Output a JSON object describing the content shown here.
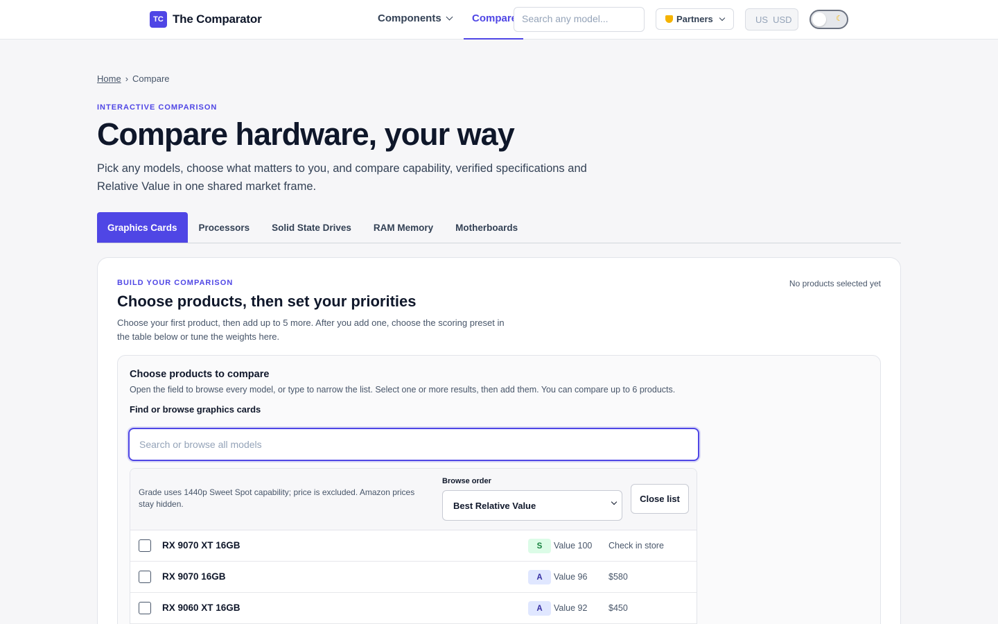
{
  "header": {
    "logo_mark": "TC",
    "logo_text": "The Comparator",
    "nav_components": "Components",
    "nav_compare": "Compare",
    "search_placeholder": "Search any model...",
    "partners": "Partners",
    "currency_country": "US",
    "currency_code": "USD",
    "theme_icon": "moon-icon"
  },
  "breadcrumb": {
    "home": "Home",
    "separator": "›",
    "current": "Compare"
  },
  "hero": {
    "eyebrow": "INTERACTIVE COMPARISON",
    "title": "Compare hardware, your way",
    "subtitle": "Pick any models, choose what matters to you, and compare capability, verified specifications and Relative Value in one shared market frame."
  },
  "tabs": [
    "Graphics Cards",
    "Processors",
    "Solid State Drives",
    "RAM Memory",
    "Motherboards"
  ],
  "builder": {
    "eyebrow": "BUILD YOUR COMPARISON",
    "title": "Choose products, then set your priorities",
    "description": "Choose your first product, then add up to 5 more. After you add one, choose the scoring preset in the table below or tune the weights here.",
    "status": "No products selected yet",
    "picker": {
      "title": "Choose products to compare",
      "description": "Open the field to browse every model, or type to narrow the list. Select one or more results, then add them. You can compare up to 6 products.",
      "field_label": "Find or browse graphics cards",
      "placeholder": "Search or browse all models",
      "note": "Grade uses 1440p Sweet Spot capability; price is excluded. Amazon prices stay hidden.",
      "order_label": "Browse order",
      "order_value": "Best Relative Value",
      "close_label": "Close list",
      "rows": [
        {
          "name": "RX 9070 XT 16GB",
          "grade": "S",
          "value": "Value 100",
          "price": "Check in store"
        },
        {
          "name": "RX 9070 16GB",
          "grade": "A",
          "value": "Value 96",
          "price": "$580"
        },
        {
          "name": "RX 9060 XT 16GB",
          "grade": "A",
          "value": "Value 92",
          "price": "$450"
        }
      ]
    }
  },
  "colors": {
    "accent": "#4f46e5",
    "grade_s_bg": "#dcfce7",
    "grade_s_fg": "#15803d",
    "grade_a_bg": "#e0e7ff",
    "grade_a_fg": "#3730a3"
  }
}
